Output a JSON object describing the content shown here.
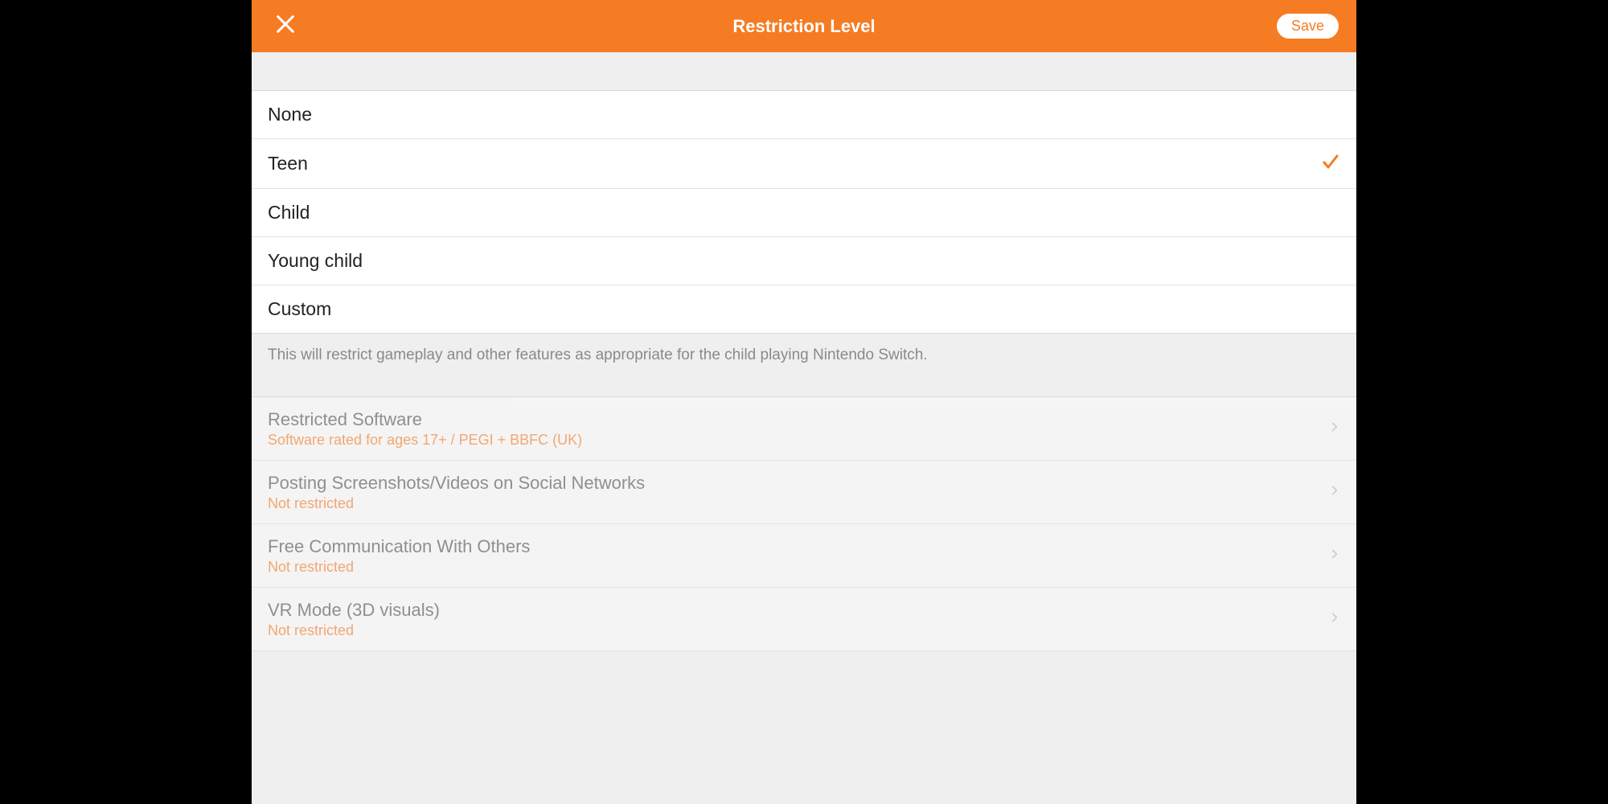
{
  "header": {
    "title": "Restriction Level",
    "save_label": "Save"
  },
  "levels": [
    {
      "label": "None",
      "selected": false
    },
    {
      "label": "Teen",
      "selected": true
    },
    {
      "label": "Child",
      "selected": false
    },
    {
      "label": "Young child",
      "selected": false
    },
    {
      "label": "Custom",
      "selected": false
    }
  ],
  "description": "This will restrict gameplay and other features as appropriate for the child playing Nintendo Switch.",
  "settings": [
    {
      "title": "Restricted Software",
      "subtitle": "Software rated for ages 17+ / PEGI + BBFC (UK)"
    },
    {
      "title": "Posting Screenshots/Videos on Social Networks",
      "subtitle": "Not restricted"
    },
    {
      "title": "Free Communication With Others",
      "subtitle": "Not restricted"
    },
    {
      "title": "VR Mode (3D visuals)",
      "subtitle": "Not restricted"
    }
  ],
  "colors": {
    "accent": "#f57c23"
  }
}
